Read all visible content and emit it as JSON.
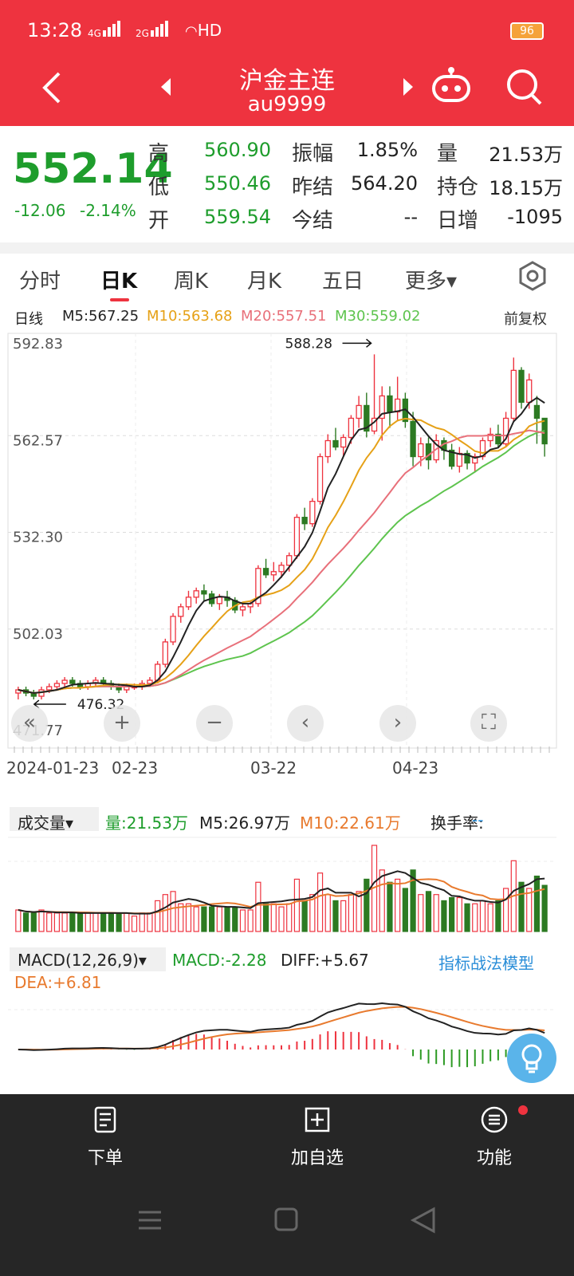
{
  "status": {
    "time": "13:28",
    "net1": "4G",
    "net2": "2G",
    "hd": "HD",
    "battery": "96"
  },
  "nav": {
    "title": "沪金主连",
    "code": "au9999"
  },
  "quote": {
    "price": "552.14",
    "change": "-12.06",
    "change_pct": "-2.14%",
    "high_label": "高",
    "high": "560.90",
    "low_label": "低",
    "low": "550.46",
    "open_label": "开",
    "open": "559.54",
    "amp_label": "振幅",
    "amp": "1.85%",
    "prev_settle_label": "昨结",
    "prev_settle": "564.20",
    "settle_label": "今结",
    "settle": "--",
    "vol_label": "量",
    "vol": "21.53万",
    "oi_label": "持仓",
    "oi": "18.15万",
    "daily_inc_label": "日增",
    "daily_inc": "-1095"
  },
  "tabs": [
    "分时",
    "日K",
    "周K",
    "月K",
    "五日",
    "更多▾"
  ],
  "ma": {
    "period": "日线",
    "m5": "M5:567.25",
    "m10": "M10:563.68",
    "m20": "M20:557.51",
    "m30": "M30:559.02",
    "adjust": "前复权"
  },
  "colors": {
    "red": "#ee333f",
    "green": "#1e9d2c",
    "ma5": "#222222",
    "ma10": "#e6a117",
    "ma20": "#e8707a",
    "ma30": "#5ec44e"
  },
  "chart_data": {
    "type": "candlestick",
    "y_ticks": [
      "592.83",
      "562.57",
      "532.30",
      "502.03",
      "471.77"
    ],
    "ylim": [
      471.77,
      592.83
    ],
    "max_label": "588.28",
    "min_label": "476.32",
    "x_ticks": [
      "2024-01-23",
      "02-23",
      "03-22",
      "04-23"
    ],
    "candles": [
      [
        482,
        484,
        480,
        483
      ],
      [
        483,
        484,
        481,
        482
      ],
      [
        482,
        483,
        480,
        481
      ],
      [
        481,
        484,
        480,
        483
      ],
      [
        483,
        485,
        482,
        484
      ],
      [
        484,
        486,
        483,
        485
      ],
      [
        485,
        487,
        484,
        486
      ],
      [
        486,
        487,
        484,
        485
      ],
      [
        485,
        486,
        483,
        484
      ],
      [
        484,
        486,
        483,
        485
      ],
      [
        485,
        487,
        484,
        486
      ],
      [
        486,
        487,
        484,
        485
      ],
      [
        485,
        486,
        483,
        484
      ],
      [
        484,
        485,
        482,
        483
      ],
      [
        483,
        485,
        482,
        484
      ],
      [
        484,
        485,
        483,
        484
      ],
      [
        484,
        486,
        483,
        485
      ],
      [
        485,
        487,
        484,
        486
      ],
      [
        486,
        492,
        485,
        491
      ],
      [
        491,
        499,
        490,
        498
      ],
      [
        498,
        507,
        497,
        506
      ],
      [
        506,
        510,
        504,
        509
      ],
      [
        509,
        514,
        508,
        512
      ],
      [
        512,
        515,
        510,
        514
      ],
      [
        514,
        516,
        511,
        513
      ],
      [
        513,
        514,
        509,
        510
      ],
      [
        510,
        513,
        508,
        512
      ],
      [
        512,
        514,
        509,
        511
      ],
      [
        511,
        512,
        507,
        508
      ],
      [
        508,
        510,
        506,
        509
      ],
      [
        509,
        511,
        507,
        510
      ],
      [
        510,
        522,
        509,
        521
      ],
      [
        521,
        524,
        518,
        519
      ],
      [
        519,
        523,
        517,
        520
      ],
      [
        520,
        523,
        518,
        522
      ],
      [
        522,
        526,
        520,
        525
      ],
      [
        525,
        538,
        524,
        537
      ],
      [
        537,
        540,
        533,
        535
      ],
      [
        535,
        543,
        534,
        542
      ],
      [
        542,
        557,
        541,
        556
      ],
      [
        556,
        563,
        554,
        561
      ],
      [
        561,
        565,
        558,
        559
      ],
      [
        559,
        563,
        556,
        562
      ],
      [
        562,
        569,
        560,
        568
      ],
      [
        568,
        575,
        565,
        572
      ],
      [
        572,
        576,
        562,
        564
      ],
      [
        564,
        588,
        563,
        568
      ],
      [
        568,
        578,
        561,
        575
      ],
      [
        575,
        578,
        565,
        570
      ],
      [
        570,
        581,
        567,
        574
      ],
      [
        574,
        576,
        565,
        567
      ],
      [
        567,
        570,
        553,
        556
      ],
      [
        556,
        562,
        553,
        560
      ],
      [
        560,
        562,
        552,
        555
      ],
      [
        555,
        563,
        554,
        561
      ],
      [
        561,
        562,
        555,
        558
      ],
      [
        558,
        560,
        552,
        553
      ],
      [
        553,
        559,
        551,
        557
      ],
      [
        557,
        558,
        552,
        554
      ],
      [
        554,
        557,
        551,
        556
      ],
      [
        556,
        562,
        555,
        561
      ],
      [
        561,
        565,
        559,
        563
      ],
      [
        563,
        566,
        559,
        560
      ],
      [
        560,
        570,
        559,
        568
      ],
      [
        568,
        587,
        567,
        583
      ],
      [
        583,
        584,
        571,
        573
      ],
      [
        573,
        582,
        571,
        580
      ],
      [
        572,
        575,
        560,
        568
      ],
      [
        568,
        568,
        556,
        560
      ]
    ],
    "volume_header": {
      "label": "成交量▾",
      "vol": "量:21.53万",
      "m5": "M5:26.97万",
      "m10": "M10:22.61万",
      "turnover_label": "换手率:",
      "turnover": "--"
    },
    "macd_header": {
      "label": "MACD(12,26,9)▾",
      "macd": "MACD:-2.28",
      "diff": "DIFF:+5.67",
      "dea": "DEA:+6.81",
      "strategy": "指标战法模型"
    }
  },
  "bottom": {
    "order": "下单",
    "add": "加自选",
    "func": "功能"
  }
}
